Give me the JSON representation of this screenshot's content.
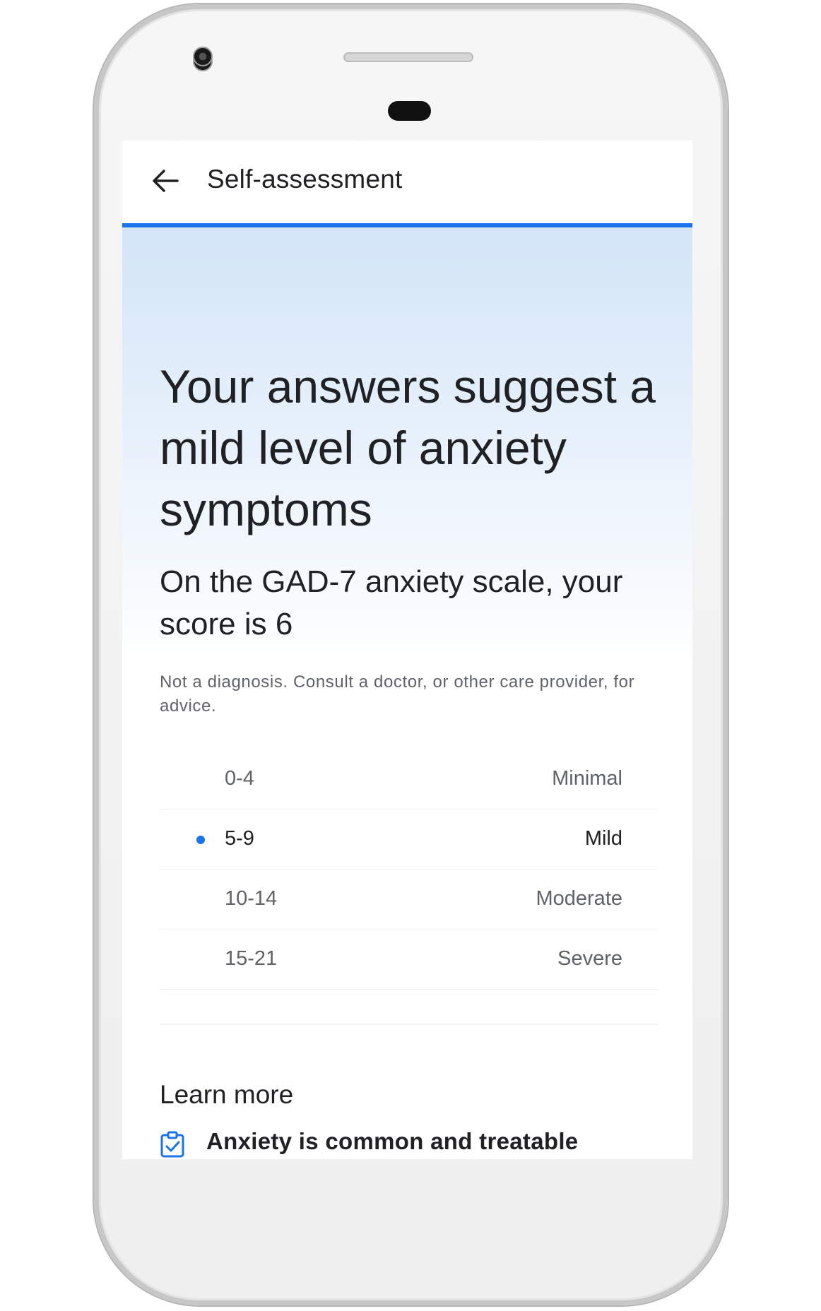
{
  "appbar": {
    "title": "Self-assessment",
    "back_icon": "arrow-back-icon"
  },
  "result": {
    "headline": "Your answers suggest a mild level of anxiety symptoms",
    "score_text": "On the GAD-7 anxiety scale, your score is 6",
    "disclaimer": "Not a diagnosis. Consult a doctor, or other care provider, for advice."
  },
  "scale": [
    {
      "range": "0-4",
      "level": "Minimal",
      "active": false
    },
    {
      "range": "5-9",
      "level": "Mild",
      "active": true
    },
    {
      "range": "10-14",
      "level": "Moderate",
      "active": false
    },
    {
      "range": "15-21",
      "level": "Severe",
      "active": false
    }
  ],
  "learn_more": {
    "title": "Learn more",
    "items": [
      {
        "label": "Anxiety is common and treatable",
        "icon": "clipboard-check-icon"
      }
    ]
  },
  "colors": {
    "accent": "#1a73e8",
    "text": "#202124",
    "secondary": "#5f6368"
  }
}
